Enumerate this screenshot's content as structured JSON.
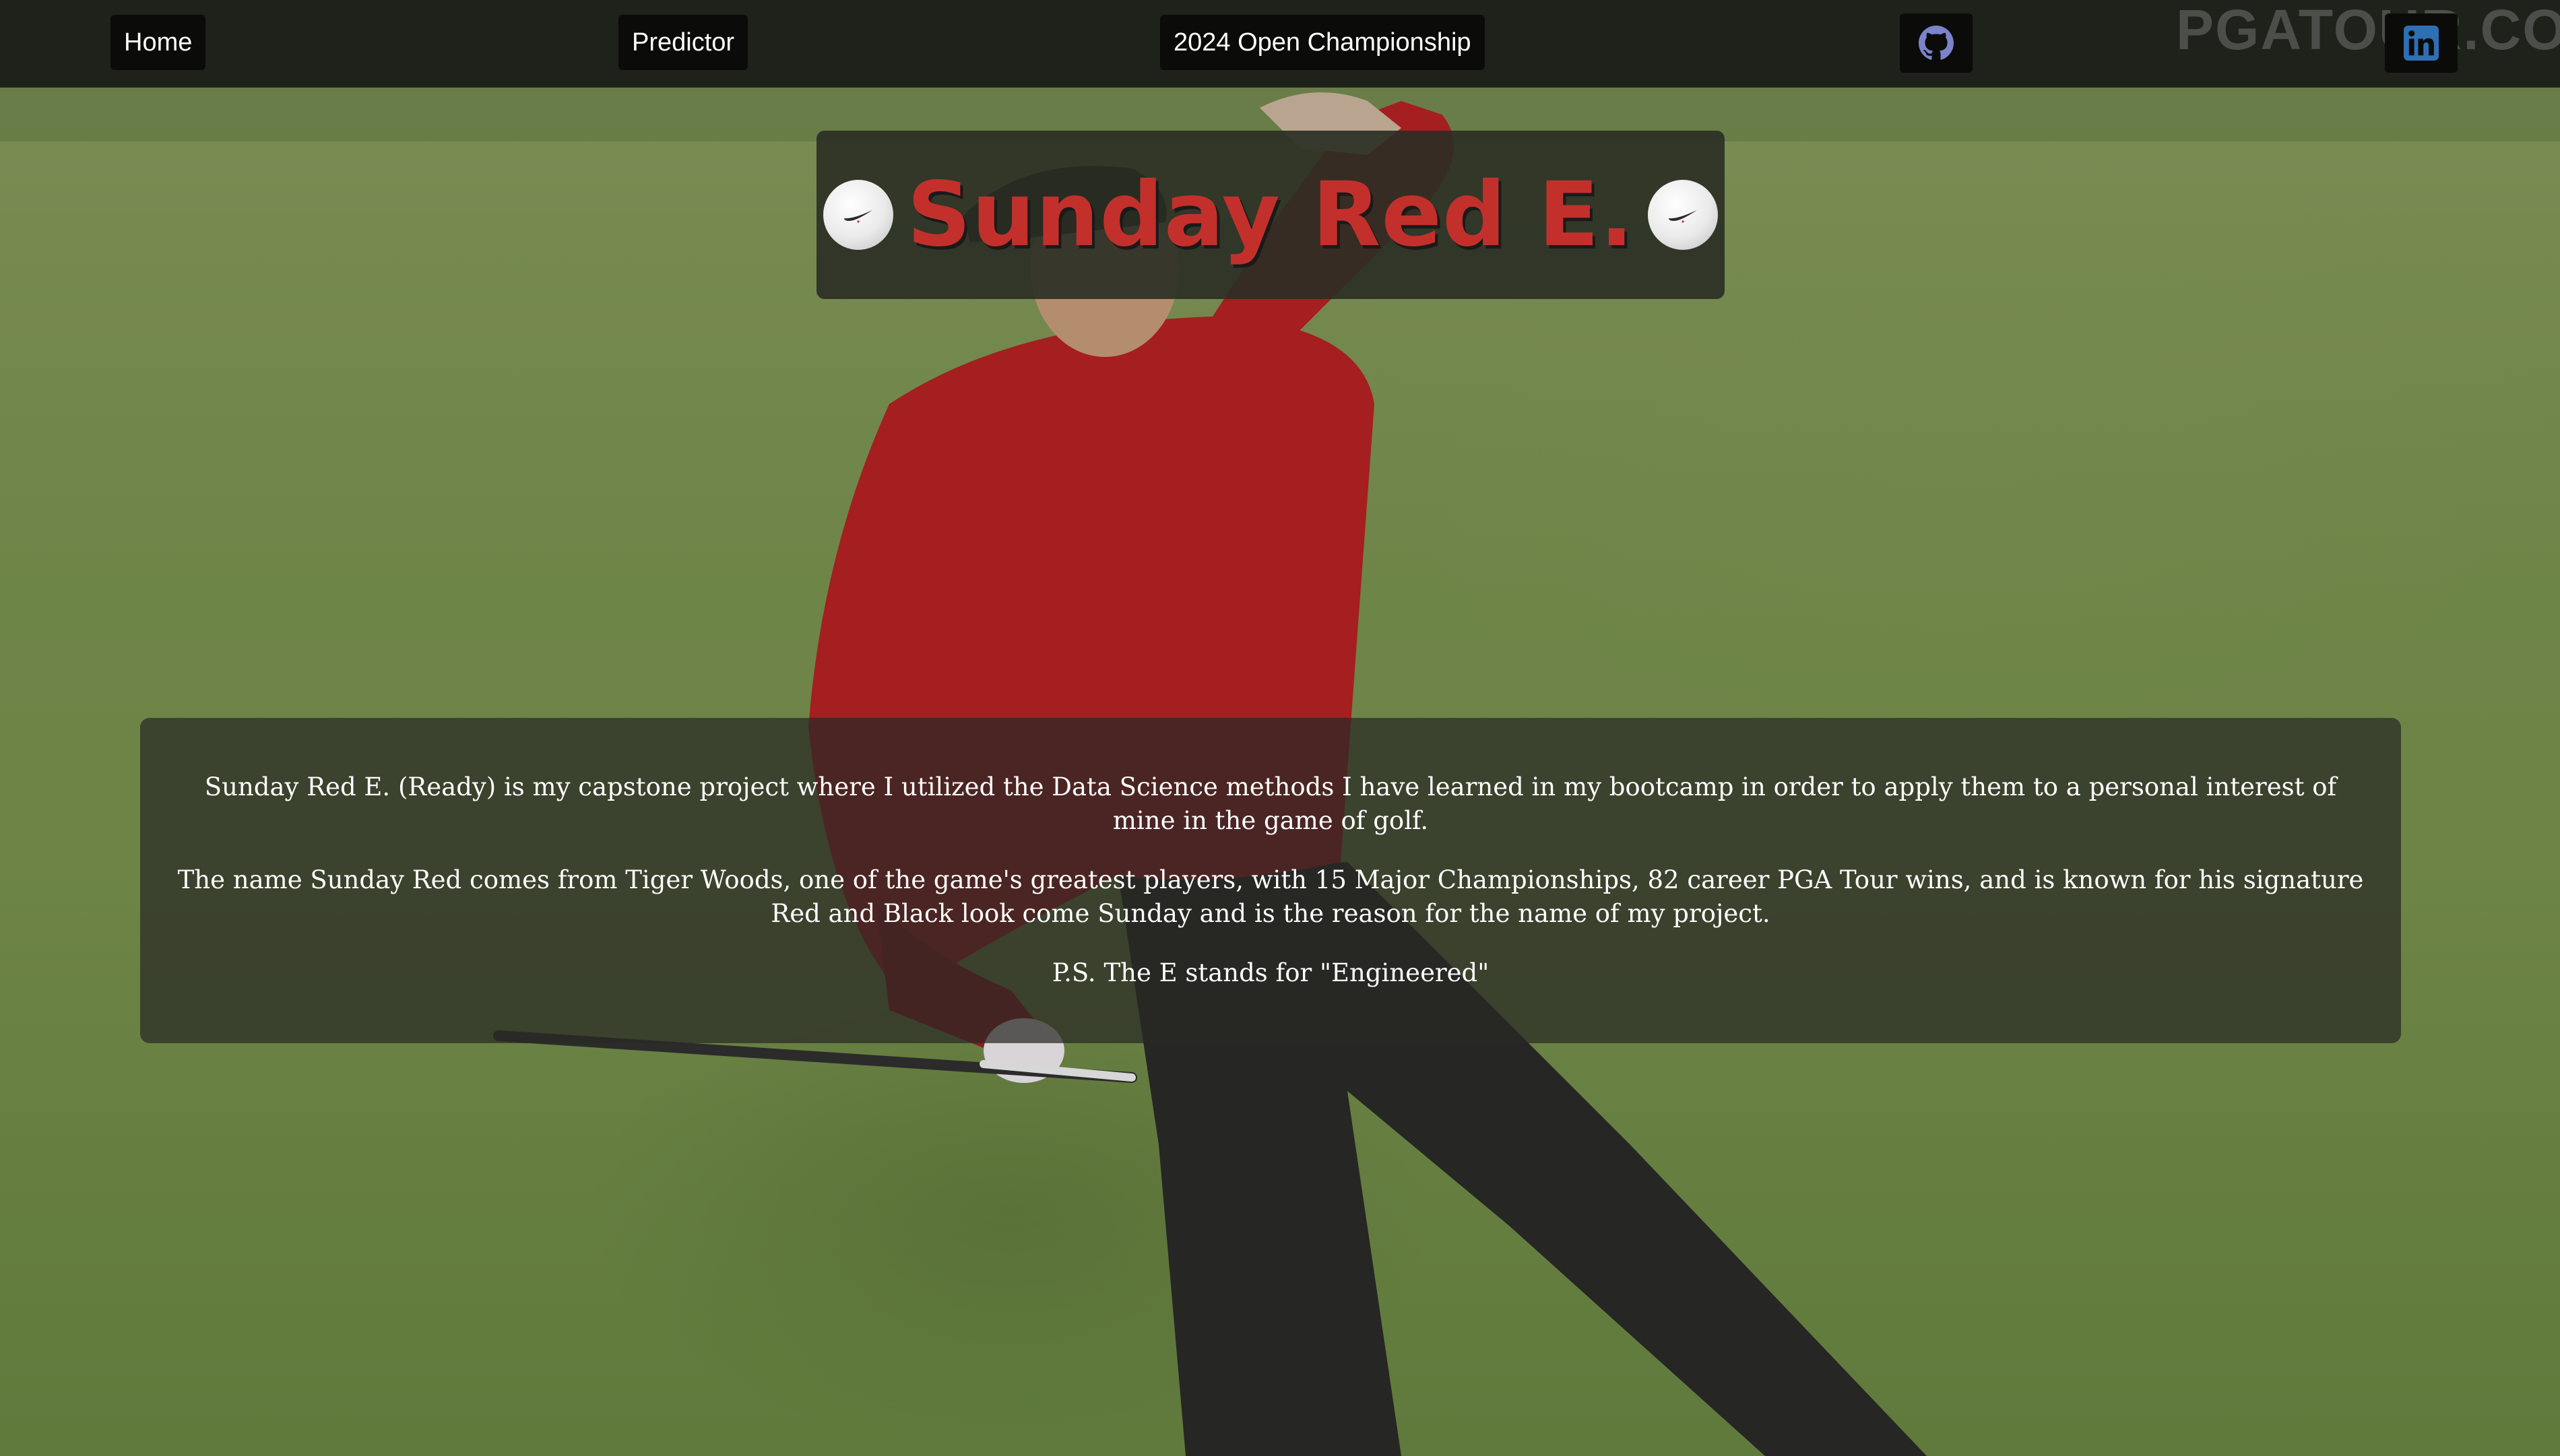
{
  "nav": {
    "home": "Home",
    "predictor": "Predictor",
    "championship": "2024 Open Championship",
    "github_icon": "github-icon",
    "linkedin_icon": "linkedin-icon"
  },
  "watermark": "PGATOUR.COM",
  "hero": {
    "title": "Sunday Red E.",
    "left_icon": "golf-ball-icon",
    "right_icon": "golf-ball-icon"
  },
  "about": {
    "paragraph_1": "Sunday Red E. (Ready) is my capstone project where I utilized the Data Science methods I have learned in my bootcamp in order to apply them to a personal interest of mine in the game of golf.",
    "paragraph_2": "The name Sunday Red comes from Tiger Woods, one of the game's greatest players, with 15 Major Championships, 82 career PGA Tour wins, and is known for his signature Red and Black look come Sunday and is the reason for the name of my project.",
    "paragraph_3": "P.S. The E stands for \"Engineered\""
  },
  "colors": {
    "title_red": "#c3302c",
    "nav_bg": "#1f221b",
    "github_accent": "#7b84c9",
    "linkedin_accent": "#2f6fb3"
  }
}
